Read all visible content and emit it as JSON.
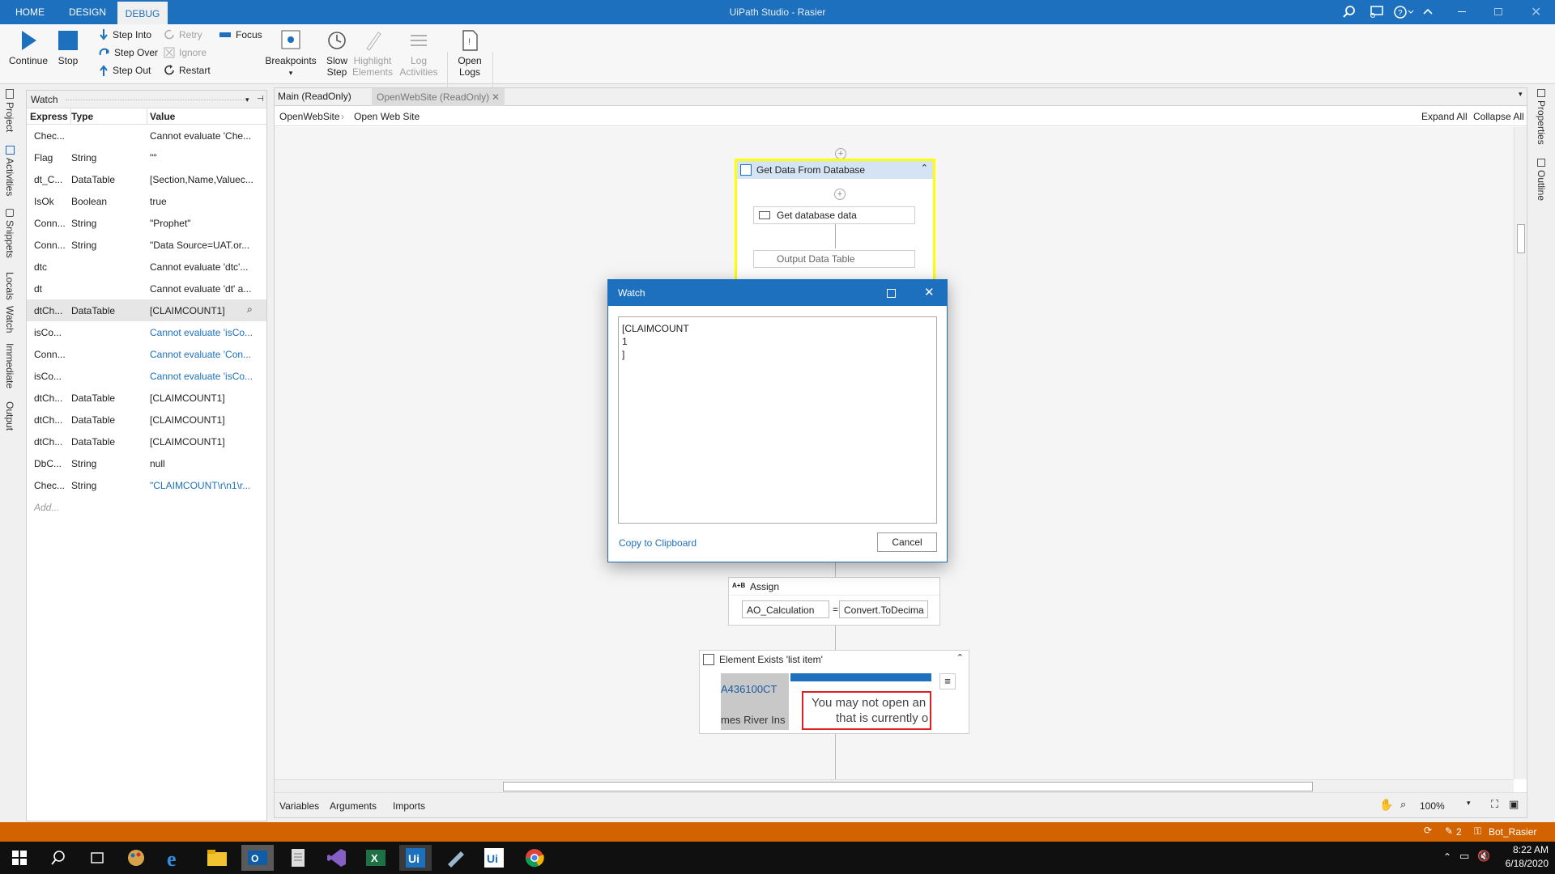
{
  "window": {
    "title": "UiPath Studio - Rasier"
  },
  "tabs": [
    {
      "label": "HOME"
    },
    {
      "label": "DESIGN"
    },
    {
      "label": "DEBUG"
    }
  ],
  "ribbon": {
    "continue": "Continue",
    "stop": "Stop",
    "step_into": "Step Into",
    "step_over": "Step Over",
    "step_out": "Step Out",
    "retry": "Retry",
    "ignore": "Ignore",
    "restart": "Restart",
    "focus": "Focus",
    "breakpoints": "Breakpoints",
    "slow_step_1": "Slow",
    "slow_step_2": "Step",
    "highlight_1": "Highlight",
    "highlight_2": "Elements",
    "log_1": "Log",
    "log_2": "Activities",
    "open_logs_1": "Open",
    "open_logs_2": "Logs"
  },
  "left_tabs": [
    "Project",
    "Activities",
    "Snippets",
    "Locals",
    "Watch",
    "Immediate",
    "Output"
  ],
  "right_tabs": [
    "Properties",
    "Outline"
  ],
  "watch_panel": {
    "title": "Watch",
    "columns": [
      "Express",
      "Type",
      "Value"
    ],
    "rows": [
      {
        "expr": "Chec...",
        "type": "",
        "value": "Cannot evaluate 'Che...",
        "blue": false
      },
      {
        "expr": "Flag",
        "type": "String",
        "value": "\"\"",
        "blue": false
      },
      {
        "expr": "dt_C...",
        "type": "DataTable",
        "value": "[Section,Name,Valuec...",
        "blue": false
      },
      {
        "expr": "IsOk",
        "type": "Boolean",
        "value": "true",
        "blue": false
      },
      {
        "expr": "Conn...",
        "type": "String",
        "value": "\"Prophet\"",
        "blue": false
      },
      {
        "expr": "Conn...",
        "type": "String",
        "value": "\"Data Source=UAT.or...",
        "blue": false
      },
      {
        "expr": "dtc",
        "type": "",
        "value": "Cannot evaluate 'dtc'...",
        "blue": false
      },
      {
        "expr": "dt",
        "type": "",
        "value": "Cannot evaluate 'dt' a...",
        "blue": false
      },
      {
        "expr": "dtCh...",
        "type": "DataTable",
        "value": "[CLAIMCOUNT1]",
        "blue": false,
        "selected": true
      },
      {
        "expr": "isCo...",
        "type": "",
        "value": "Cannot evaluate 'isCo...",
        "blue": true
      },
      {
        "expr": "Conn...",
        "type": "",
        "value": "Cannot evaluate 'Con...",
        "blue": true
      },
      {
        "expr": "isCo...",
        "type": "",
        "value": "Cannot evaluate 'isCo...",
        "blue": true
      },
      {
        "expr": "dtCh...",
        "type": "DataTable",
        "value": "[CLAIMCOUNT1]",
        "blue": false
      },
      {
        "expr": "dtCh...",
        "type": "DataTable",
        "value": "[CLAIMCOUNT1]",
        "blue": false
      },
      {
        "expr": "dtCh...",
        "type": "DataTable",
        "value": "[CLAIMCOUNT1]",
        "blue": false
      },
      {
        "expr": "DbC...",
        "type": "String",
        "value": "null",
        "blue": false
      },
      {
        "expr": "Chec...",
        "type": "String",
        "value": "\"CLAIMCOUNT\\r\\n1\\r...",
        "blue": true
      }
    ],
    "add_placeholder": "Add..."
  },
  "doc_tabs": [
    {
      "label": "Main (ReadOnly)"
    },
    {
      "label": "OpenWebSite (ReadOnly)"
    }
  ],
  "breadcrumb": [
    "OpenWebSite",
    "Open Web Site"
  ],
  "expand_all": "Expand All",
  "collapse_all": "Collapse All",
  "workflow": {
    "sequence_title": "Get Data From Database",
    "get_db": "Get database data",
    "output_dt_partial": "Output Data Table",
    "assign_title": "Assign",
    "assign_tag": "A+B",
    "assign_left": "AO_Calculation",
    "assign_right": "Convert.ToDecima",
    "element_exists_title": "Element Exists 'list item'",
    "preview_text1": "A436100CT",
    "preview_text2": "mes River Ins",
    "preview_msg1": "You may not open an",
    "preview_msg2": "that is currently o"
  },
  "bottom_tabs": [
    "Variables",
    "Arguments",
    "Imports"
  ],
  "zoom": "100%",
  "dialog": {
    "title": "Watch",
    "content": "[CLAIMCOUNT\n1\n]",
    "copy": "Copy to Clipboard",
    "cancel": "Cancel"
  },
  "status": {
    "count": "2",
    "user": "Bot_Rasier"
  },
  "clock": {
    "time": "8:22 AM",
    "date": "6/18/2020"
  }
}
